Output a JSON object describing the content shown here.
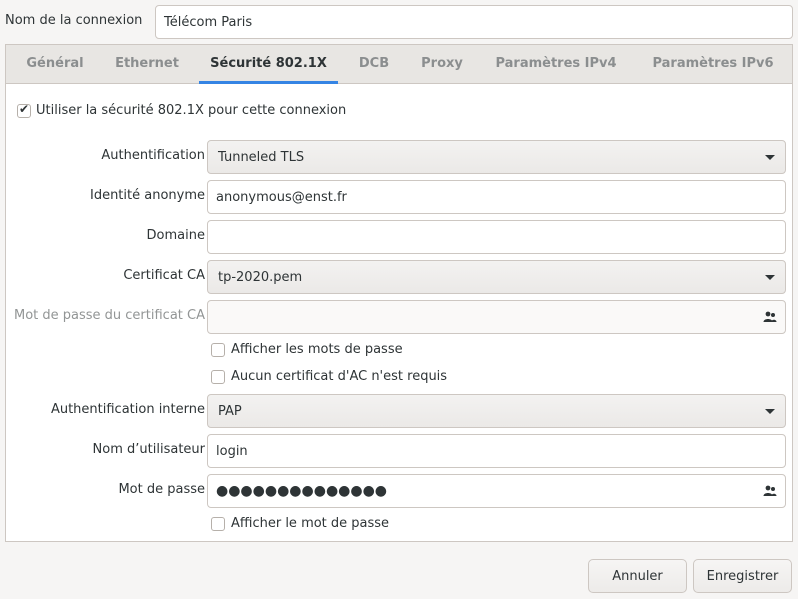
{
  "connection": {
    "name_label": "Nom de la connexion",
    "name_value": "Télécom Paris"
  },
  "tabs": [
    {
      "label": "Général",
      "active": false
    },
    {
      "label": "Ethernet",
      "active": false
    },
    {
      "label": "Sécurité 802.1X",
      "active": true
    },
    {
      "label": "DCB",
      "active": false
    },
    {
      "label": "Proxy",
      "active": false
    },
    {
      "label": "Paramètres IPv4",
      "active": false
    },
    {
      "label": "Paramètres IPv6",
      "active": false
    }
  ],
  "security": {
    "use_8021x_label": "Utiliser la sécurité 802.1X pour cette connexion",
    "use_8021x_checked": true,
    "auth_label": "Authentification",
    "auth_value": "Tunneled TLS",
    "anon_label": "Identité anonyme",
    "anon_value": "anonymous@enst.fr",
    "domain_label": "Domaine",
    "domain_value": "",
    "ca_label": "Certificat CA",
    "ca_value": "tp-2020.pem",
    "ca_pw_label": "Mot de passe du certificat CA",
    "ca_pw_value": "",
    "show_passwords_label": "Afficher les mots de passe",
    "show_passwords_checked": false,
    "no_ca_label": "Aucun certificat d'AC n'est requis",
    "no_ca_checked": false,
    "inner_auth_label": "Authentification interne",
    "inner_auth_value": "PAP",
    "username_label": "Nom d’utilisateur",
    "username_value": "login",
    "password_label": "Mot de passe",
    "password_value": "●●●●●●●●●●●●●●",
    "show_password_label": "Afficher le mot de passe",
    "show_password_checked": false
  },
  "icons": {
    "password_storage": "people-icon"
  },
  "buttons": {
    "cancel": "Annuler",
    "save": "Enregistrer"
  },
  "colors": {
    "accent": "#3584e4",
    "background": "#f6f5f4"
  }
}
